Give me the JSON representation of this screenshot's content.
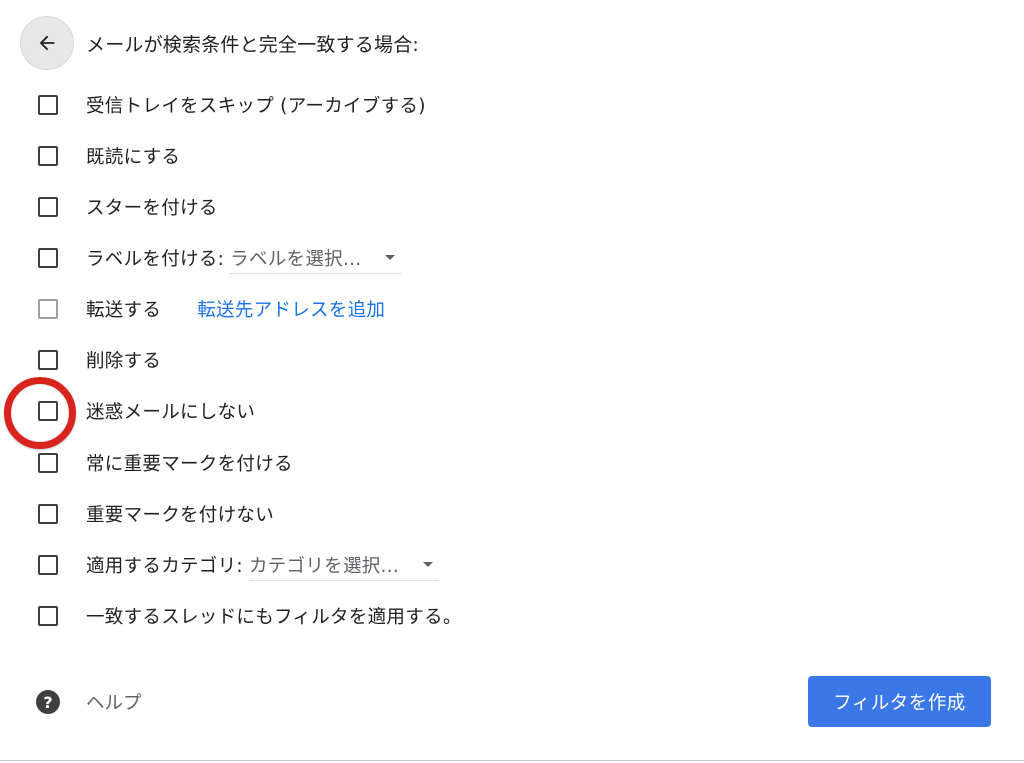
{
  "header": {
    "title": "メールが検索条件と完全一致する場合:",
    "back_icon": "arrow-left-icon"
  },
  "options": [
    {
      "label": "受信トレイをスキップ (アーカイブする)",
      "checked": false
    },
    {
      "label": "既読にする",
      "checked": false
    },
    {
      "label": "スターを付ける",
      "checked": false
    },
    {
      "label": "ラベルを付ける:",
      "checked": false,
      "select_value": "ラベルを選択..."
    },
    {
      "label": "転送する",
      "checked": false,
      "disabled": true,
      "link": "転送先アドレスを追加"
    },
    {
      "label": "削除する",
      "checked": false
    },
    {
      "label": "迷惑メールにしない",
      "checked": false,
      "highlighted": true
    },
    {
      "label": "常に重要マークを付ける",
      "checked": false
    },
    {
      "label": "重要マークを付けない",
      "checked": false
    },
    {
      "label": "適用するカテゴリ:",
      "checked": false,
      "select_value": "カテゴリを選択..."
    },
    {
      "label": "一致するスレッドにもフィルタを適用する。",
      "checked": false
    }
  ],
  "footer": {
    "help_icon": "question-circle-icon",
    "help_label": "ヘルプ",
    "create_button": "フィルタを作成"
  },
  "colors": {
    "accent": "#3b78e7",
    "link": "#1a73e8",
    "highlight_ring": "#d9231f"
  }
}
